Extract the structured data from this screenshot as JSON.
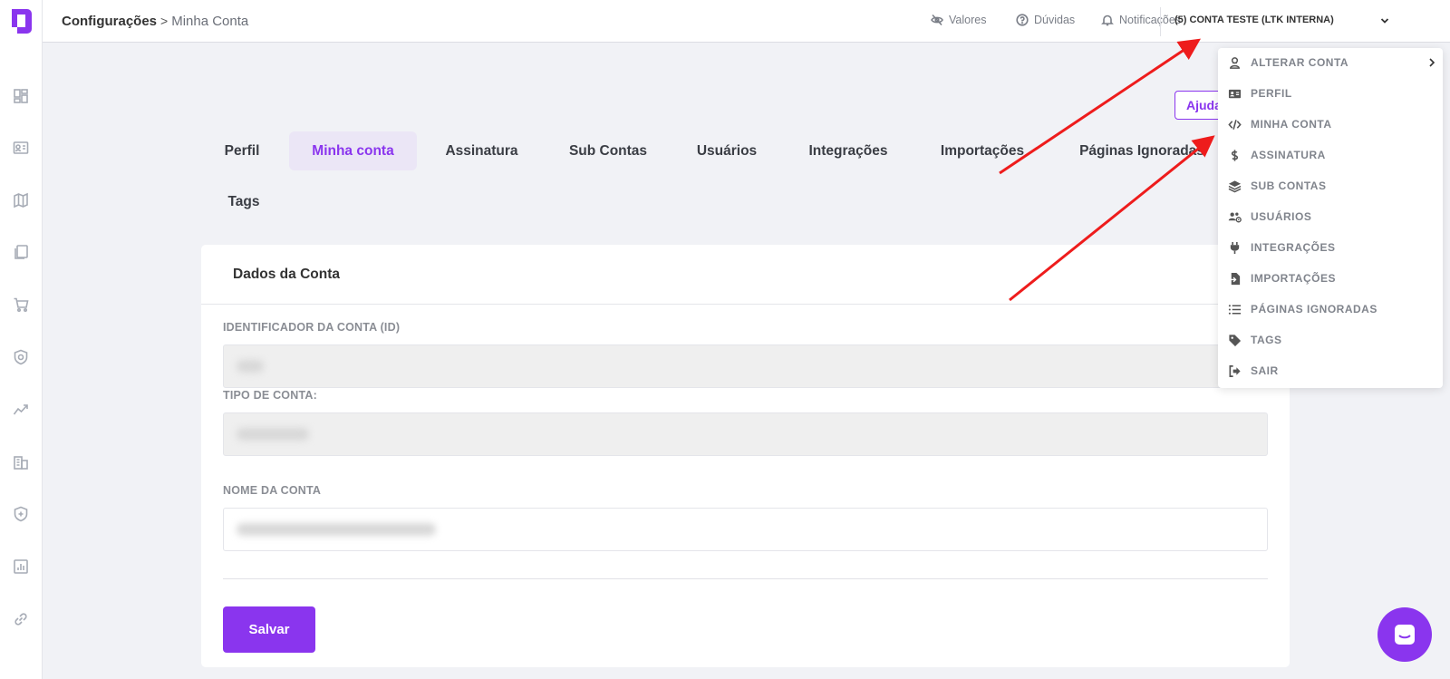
{
  "breadcrumb": {
    "root": "Configurações",
    "separator": ">",
    "current": "Minha Conta"
  },
  "topbar": {
    "values_label": "Valores",
    "help_label": "Dúvidas",
    "notifications_label": "Notificações",
    "account_name": "(5) CONTA TESTE (LTK INTERNA)"
  },
  "tabs": [
    {
      "label": "Perfil",
      "active": false
    },
    {
      "label": "Minha conta",
      "active": true
    },
    {
      "label": "Assinatura",
      "active": false
    },
    {
      "label": "Sub Contas",
      "active": false
    },
    {
      "label": "Usuários",
      "active": false
    },
    {
      "label": "Integrações",
      "active": false
    },
    {
      "label": "Importações",
      "active": false
    },
    {
      "label": "Páginas Ignoradas",
      "active": false
    },
    {
      "label": "Tags",
      "active": false
    }
  ],
  "help_button": "Ajuda",
  "card": {
    "title": "Dados da Conta",
    "fields": [
      {
        "label": "IDENTIFICADOR DA CONTA (ID)",
        "value": "",
        "readonly": true
      },
      {
        "label": "TIPO DE CONTA:",
        "value": "",
        "readonly": true
      },
      {
        "label": "NOME DA CONTA",
        "value": "",
        "readonly": false
      }
    ],
    "save_label": "Salvar"
  },
  "dropdown": {
    "items": [
      {
        "label": "ALTERAR CONTA",
        "icon": "user-switch-icon",
        "has_submenu": true
      },
      {
        "label": "PERFIL",
        "icon": "id-card-icon",
        "has_submenu": false
      },
      {
        "label": "MINHA CONTA",
        "icon": "code-icon",
        "has_submenu": false
      },
      {
        "label": "ASSINATURA",
        "icon": "dollar-icon",
        "has_submenu": false
      },
      {
        "label": "SUB CONTAS",
        "icon": "layers-icon",
        "has_submenu": false
      },
      {
        "label": "USUÁRIOS",
        "icon": "users-gear-icon",
        "has_submenu": false
      },
      {
        "label": "INTEGRAÇÕES",
        "icon": "plug-icon",
        "has_submenu": false
      },
      {
        "label": "IMPORTAÇÕES",
        "icon": "file-import-icon",
        "has_submenu": false
      },
      {
        "label": "PÁGINAS IGNORADAS",
        "icon": "list-icon",
        "has_submenu": false
      },
      {
        "label": "TAGS",
        "icon": "tag-icon",
        "has_submenu": false
      },
      {
        "label": "SAIR",
        "icon": "logout-icon",
        "has_submenu": false
      }
    ]
  },
  "colors": {
    "accent": "#8a35ee",
    "annotation_arrow": "#ee1c1c",
    "background": "#f1f2f6"
  }
}
